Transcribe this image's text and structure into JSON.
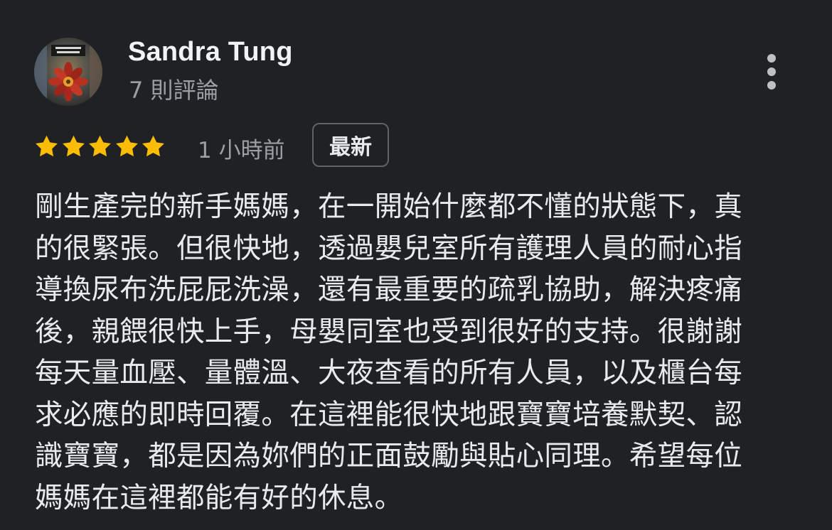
{
  "reviewer": {
    "name": "Sandra Tung",
    "review_count": "7 則評論",
    "avatar_icon": "profile-photo"
  },
  "menu": {
    "icon": "more-vert-icon"
  },
  "review": {
    "rating": 5,
    "max_rating": 5,
    "star_color": "#fbbc04",
    "time_ago": "1 小時前",
    "badge": "最新",
    "lines": [
      "剛生產完的新手媽媽，在一開始什麼都不懂的狀態下，真",
      "的很緊張。但很快地，透過嬰兒室所有護理人員的耐心指",
      "導換尿布洗屁屁洗澡，還有最重要的疏乳協助，解決疼痛",
      "後，親餵很快上手，母嬰同室也受到很好的支持。很謝謝",
      "每天量血壓、量體溫、大夜查看的所有人員，以及櫃台每",
      "求必應的即時回覆。在這裡能很快地跟寶寶培養默契、認",
      "識寶寶，都是因為妳們的正面鼓勵與貼心同理。希望每位",
      "媽媽在這裡都能有好的休息。"
    ]
  },
  "colors": {
    "background": "#202124",
    "primary_text": "#e8eaed",
    "secondary_text": "#9aa0a6",
    "badge_border": "#5f6368"
  }
}
